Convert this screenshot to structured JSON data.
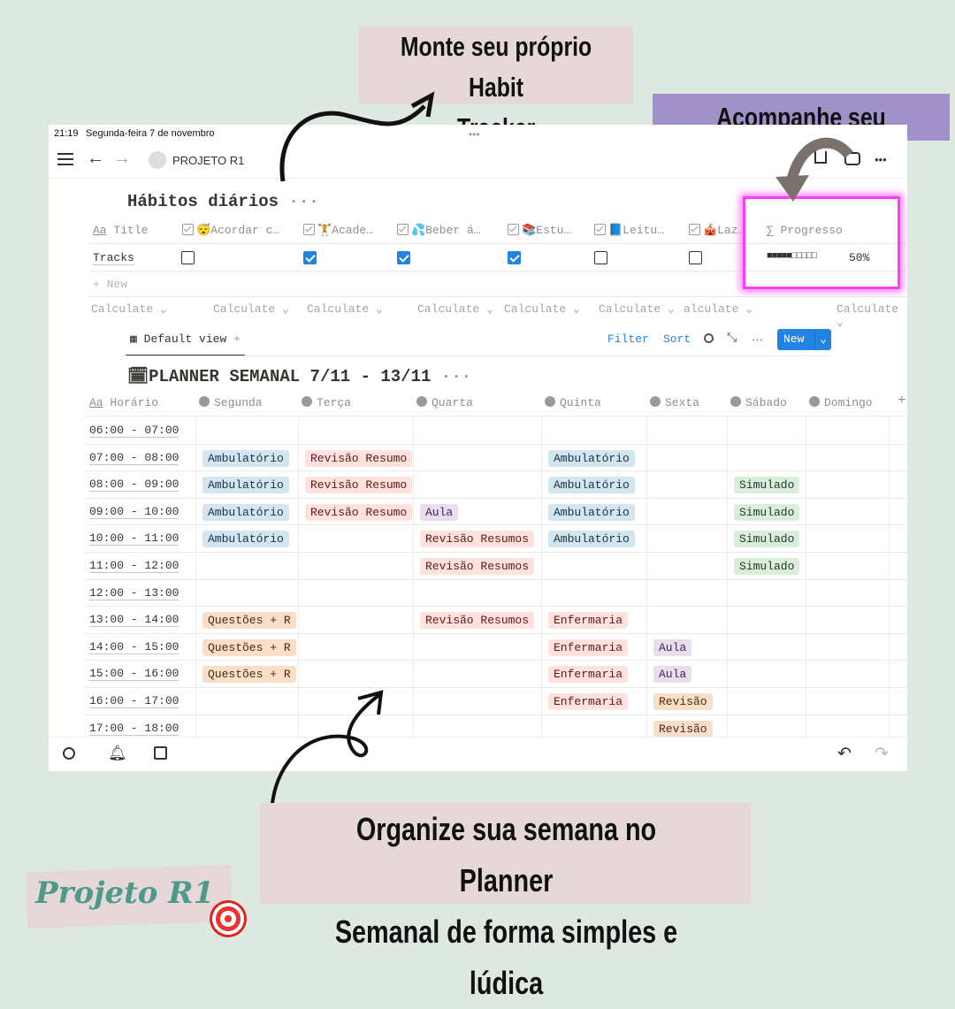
{
  "annotations": {
    "habit_tracker": [
      "Monte seu próprio Habit",
      "Tracker"
    ],
    "progress": "Acompanhe seu progresso!",
    "planner": [
      "Organize sua semana no Planner",
      "Semanal de forma simples e lúdica"
    ],
    "logo": "Projeto R1"
  },
  "status_bar": {
    "time": "21:19",
    "date": "Segunda-feira 7 de novembro",
    "dots": "•••"
  },
  "nav": {
    "page_title": "PROJETO R1",
    "more": "•••"
  },
  "habits": {
    "title": "Hábitos diários",
    "title_more": "···",
    "columns": [
      {
        "label": "Title",
        "prefix": "Aa"
      },
      {
        "label": "😴Acordar c…"
      },
      {
        "label": "🏋️Acade…"
      },
      {
        "label": "💦Beber á…"
      },
      {
        "label": "📚Estu…"
      },
      {
        "label": "📘Leitu…"
      },
      {
        "label": "🎪Laz…"
      },
      {
        "label": "Progresso",
        "prefix": "∑"
      }
    ],
    "row": {
      "title": "Tracks",
      "checks": [
        false,
        true,
        true,
        true,
        false,
        false
      ],
      "progress_bar": "■■■■■□□□□□",
      "progress_value": 0.5,
      "progress_label": "50%"
    },
    "new_label": "+ New",
    "calculate": [
      "Calculate ⌄",
      "Calculate ⌄",
      "Calculate ⌄",
      "Calculate ⌄",
      "Calculate ⌄",
      "Calculate ⌄",
      "alculate ⌄",
      "Calculate ⌄"
    ]
  },
  "toolbar": {
    "view": "Default view",
    "add": "+",
    "filter": "Filter",
    "sort": "Sort",
    "more": "···",
    "new": "New"
  },
  "planner": {
    "title": "PLANNER SEMANAL 7/11 - 13/11",
    "title_more": "···",
    "columns": [
      "Horário",
      "Segunda",
      "Terça",
      "Quarta",
      "Quinta",
      "Sexta",
      "Sábado",
      "Domingo"
    ],
    "add_column": "+",
    "rows": [
      {
        "time": "06:00 - 07:00",
        "cells": {}
      },
      {
        "time": "07:00 - 08:00",
        "cells": {
          "Segunda": "Ambulatório",
          "Terça": "Revisão Resumo",
          "Quinta": "Ambulatório"
        }
      },
      {
        "time": "08:00 - 09:00",
        "cells": {
          "Segunda": "Ambulatório",
          "Terça": "Revisão Resumo",
          "Quinta": "Ambulatório",
          "Sábado": "Simulado"
        }
      },
      {
        "time": "09:00 - 10:00",
        "cells": {
          "Segunda": "Ambulatório",
          "Terça": "Revisão Resumo",
          "Quarta": "Aula",
          "Quinta": "Ambulatório",
          "Sábado": "Simulado"
        }
      },
      {
        "time": "10:00 - 11:00",
        "cells": {
          "Segunda": "Ambulatório",
          "Quarta": "Revisão Resumos",
          "Quinta": "Ambulatório",
          "Sábado": "Simulado"
        }
      },
      {
        "time": "11:00 - 12:00",
        "cells": {
          "Quarta": "Revisão Resumos",
          "Sábado": "Simulado"
        }
      },
      {
        "time": "12:00 - 13:00",
        "cells": {}
      },
      {
        "time": "13:00 - 14:00",
        "cells": {
          "Segunda": "Questões + R",
          "Quarta": "Revisão Resumos",
          "Quinta": "Enfermaria"
        }
      },
      {
        "time": "14:00 - 15:00",
        "cells": {
          "Segunda": "Questões + R",
          "Quinta": "Enfermaria",
          "Sexta": "Aula"
        }
      },
      {
        "time": "15:00 - 16:00",
        "cells": {
          "Segunda": "Questões + R",
          "Quinta": "Enfermaria",
          "Sexta": "Aula"
        }
      },
      {
        "time": "16:00 - 17:00",
        "cells": {
          "Quinta": "Enfermaria",
          "Sexta": "Revisão"
        }
      },
      {
        "time": "17:00 - 18:00",
        "cells": {
          "Sexta": "Revisão"
        }
      }
    ],
    "tag_colors": {
      "Ambulatório": [
        "#d3e5ef",
        "#183347"
      ],
      "Revisão Resumo": [
        "#ffe2dd",
        "#5d1715"
      ],
      "Revisão Resumos": [
        "#ffe2dd",
        "#5d1715"
      ],
      "Aula": [
        "#e8deee",
        "#412454"
      ],
      "Simulado": [
        "#dbeddb",
        "#1c3829"
      ],
      "Questões + R": [
        "#fadec9",
        "#49290e"
      ],
      "Enfermaria": [
        "#ffe2dd",
        "#5d1715"
      ],
      "Revisão": [
        "#fadec9",
        "#49290e"
      ]
    }
  },
  "colors": {
    "background": "#dde8e0",
    "label_pink": "#e6d8d8",
    "label_purple": "#a191c9",
    "highlight": "#ff3df5",
    "accent": "#2383e2",
    "logo": "#4e9a8a"
  }
}
